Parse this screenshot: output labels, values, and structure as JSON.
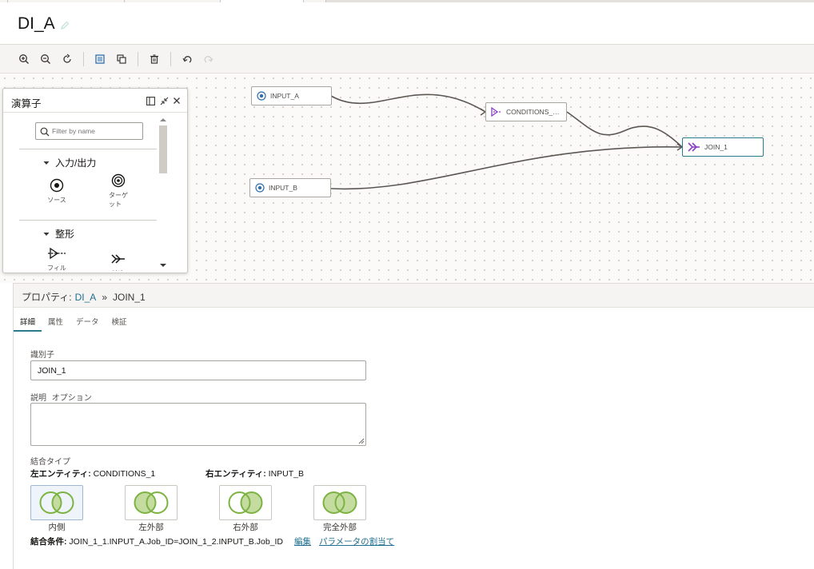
{
  "header": {
    "title": "DI_A"
  },
  "toolbar": {
    "buttons": [
      "zoom-in-icon",
      "zoom-out-icon",
      "reset-zoom-icon",
      "layout-icon",
      "duplicate-icon",
      "delete-icon",
      "undo-icon",
      "redo-icon"
    ]
  },
  "canvas": {
    "nodes": {
      "input_a": "INPUT_A",
      "input_b": "INPUT_B",
      "conditions": "CONDITIONS_…",
      "join": "JOIN_1"
    }
  },
  "palette": {
    "title": "演算子",
    "search_placeholder": "Filter by name",
    "sections": [
      {
        "label": "入力/出力",
        "items": [
          "ソース",
          "ターゲット"
        ]
      },
      {
        "label": "整形",
        "items": [
          "フィル",
          "結合"
        ]
      }
    ]
  },
  "properties": {
    "breadcrumb_prefix": "プロパティ:",
    "breadcrumb_link": "DI_A",
    "breadcrumb_sep": "»",
    "breadcrumb_current": "JOIN_1",
    "tabs": [
      "詳細",
      "属性",
      "データ",
      "検証"
    ],
    "identifier_label": "識別子",
    "identifier_value": "JOIN_1",
    "description_label": "説明",
    "description_optional": "オプション",
    "description_value": "",
    "join_type_label": "結合タイプ",
    "left_entity_label": "左エンティティ:",
    "left_entity_value": "CONDITIONS_1",
    "right_entity_label": "右エンティティ:",
    "right_entity_value": "INPUT_B",
    "join_types": [
      "内側",
      "左外部",
      "右外部",
      "完全外部"
    ],
    "join_condition_label": "結合条件:",
    "join_condition_value": "JOIN_1_1.INPUT_A.Job_ID=JOIN_1_2.INPUT_B.Job_ID",
    "edit_link": "編集",
    "assign_params_link": "パラメータの割当て"
  },
  "colors": {
    "accent": "#2a7c8a",
    "venn_green": "#7cb342",
    "venn_fill": "#c5dca0",
    "join_purple": "#8a3fc6",
    "source_blue": "#2f6fb0"
  }
}
